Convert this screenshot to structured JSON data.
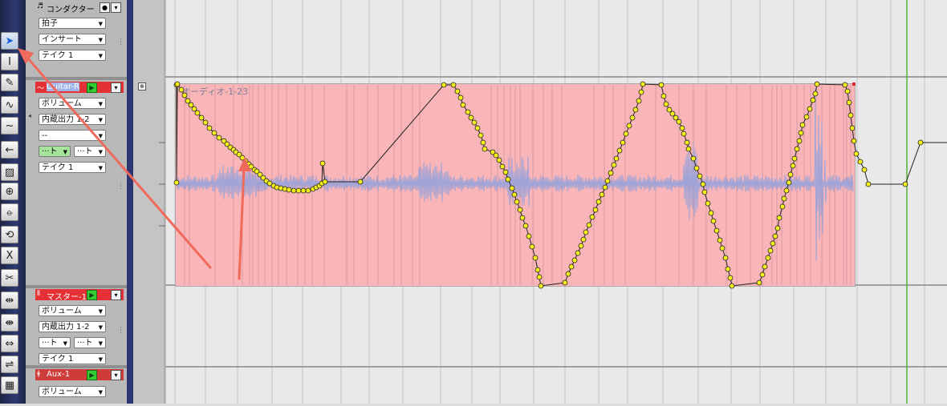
{
  "tools": [
    {
      "name": "pointer-tool-icon",
      "glyph": "➤"
    },
    {
      "name": "text-cursor-tool-icon",
      "glyph": "I"
    },
    {
      "name": "pencil-tool-icon",
      "glyph": "✎"
    },
    {
      "name": "line-tool-icon",
      "glyph": "∿"
    },
    {
      "name": "curve-tool-icon",
      "glyph": "~"
    },
    {
      "name": "arrow-left-tool-icon",
      "glyph": "←"
    },
    {
      "name": "eraser-tool-icon",
      "glyph": "▨"
    },
    {
      "name": "zoom-tool-icon",
      "glyph": "⊕"
    },
    {
      "name": "knife-tool-icon",
      "glyph": "⦵"
    },
    {
      "name": "loop-tool-icon",
      "glyph": "⟲"
    },
    {
      "name": "delete-tool-icon",
      "glyph": "X"
    },
    {
      "name": "scissors-tool-icon",
      "glyph": "✂"
    },
    {
      "name": "stretch-tool-icon",
      "glyph": "⇹"
    },
    {
      "name": "time-stretch-tool-icon",
      "glyph": "⇼"
    },
    {
      "name": "resize-tool-icon",
      "glyph": "⇔"
    },
    {
      "name": "merge-tool-icon",
      "glyph": "⇌"
    },
    {
      "name": "grid-tool-icon",
      "glyph": "▦"
    }
  ],
  "tracks": {
    "conductor": {
      "title": "コンダクター",
      "icon": "conductor-icon",
      "fields": [
        "拍子",
        "インサート",
        "テイク 1"
      ]
    },
    "guitar": {
      "title": "Guitar-R",
      "icon": "audio-icon",
      "fields": [
        "ボリューム",
        "内蔵出力 1-2",
        "--"
      ],
      "send_a": "···ト",
      "send_b": "···ト",
      "take": "テイク 1"
    },
    "master": {
      "title": "マスター-1",
      "icon": "master-icon",
      "fields": [
        "ボリューム",
        "内蔵出力 1-2"
      ],
      "send_a": "···ト",
      "send_b": "···ト",
      "take": "テイク 1"
    },
    "aux": {
      "title": "Aux-1",
      "icon": "aux-icon",
      "fields": [
        "ボリューム"
      ]
    }
  },
  "region": {
    "name": "オーディオ-1-23",
    "fill_color": "#f9b5b7",
    "waveform_color": "#9da3d8",
    "automation_color": "#f5ef1a"
  },
  "colors": {
    "track_header_red": "#e53135",
    "playhead_green": "#56b33c",
    "annotation_arrow": "#ef6a5a"
  }
}
